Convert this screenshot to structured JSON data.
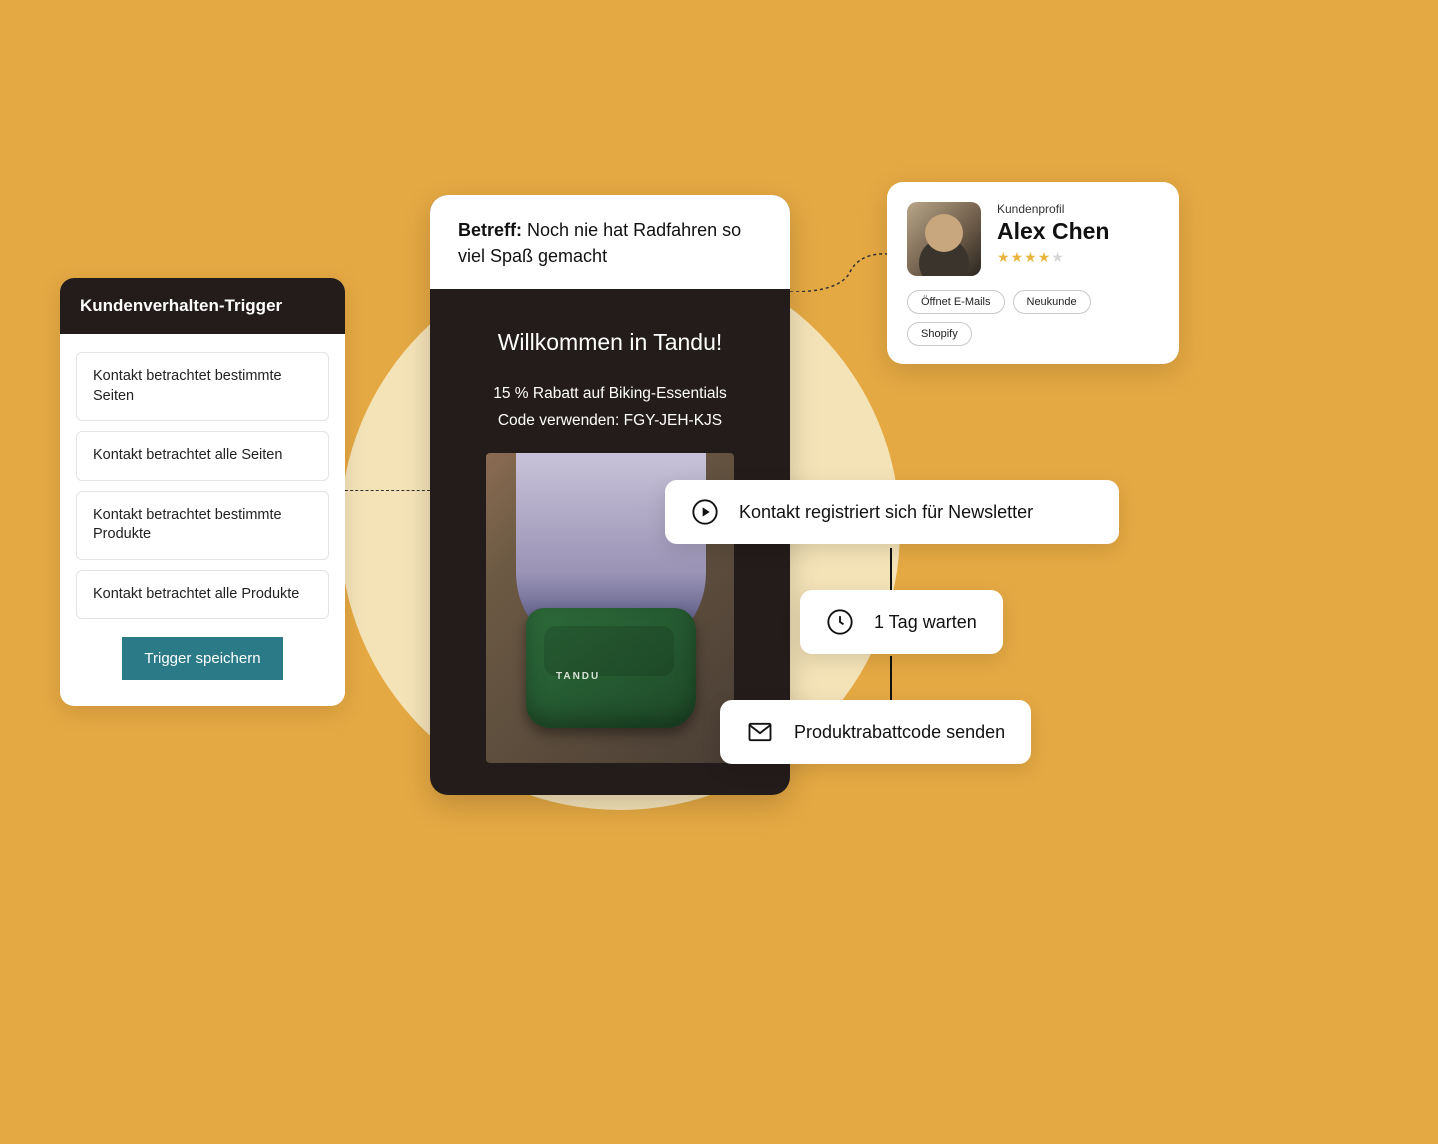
{
  "triggers": {
    "header": "Kundenverhalten-Trigger",
    "items": [
      "Kontakt betrachtet bestimmte Seiten",
      "Kontakt betrachtet alle Seiten",
      "Kontakt betrachtet bestimmte Produkte",
      "Kontakt betrachtet alle Produkte"
    ],
    "save_label": "Trigger speichern"
  },
  "email": {
    "subject_label": "Betreff:",
    "subject_text": "Noch nie hat Radfahren so viel Spaß gemacht",
    "welcome_title": "Willkommen in Tandu!",
    "discount_line": "15 % Rabatt auf Biking-Essentials",
    "code_line": "Code verwenden: FGY-JEH-KJS",
    "product_brand": "TANDU"
  },
  "profile": {
    "label": "Kundenprofil",
    "name": "Alex Chen",
    "rating": 4,
    "chips": [
      "Öffnet E-Mails",
      "Neukunde",
      "Shopify"
    ]
  },
  "automation": {
    "step1": "Kontakt registriert sich für Newsletter",
    "step2": "1 Tag warten",
    "step3": "Produktrabattcode senden"
  }
}
